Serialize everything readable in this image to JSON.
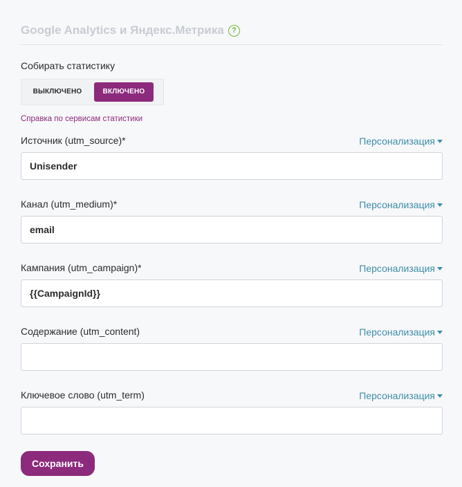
{
  "section": {
    "title": "Google Analytics и Яндекс.Метрика",
    "help_icon": "question-circle-icon",
    "help_glyph": "?"
  },
  "collect": {
    "label": "Собирать статистику",
    "off_label": "ВЫКЛЮЧЕНО",
    "on_label": "ВКЛЮЧЕНО",
    "selected": "on"
  },
  "help_link": "Справка по сервисам статистики",
  "personalize_label": "Персонализация",
  "fields": [
    {
      "label": "Источник (utm_source)*",
      "value": "Unisender"
    },
    {
      "label": "Канал (utm_medium)*",
      "value": "email"
    },
    {
      "label": "Кампания (utm_campaign)*",
      "value": "{{CampaignId}}"
    },
    {
      "label": "Содержание (utm_content)",
      "value": ""
    },
    {
      "label": "Ключевое слово (utm_term)",
      "value": ""
    }
  ],
  "save_label": "Сохранить",
  "colors": {
    "accent": "#8c2a7c",
    "link": "#3d8ea8",
    "help_icon": "#6dbb3c",
    "title": "#c7ccd2"
  }
}
